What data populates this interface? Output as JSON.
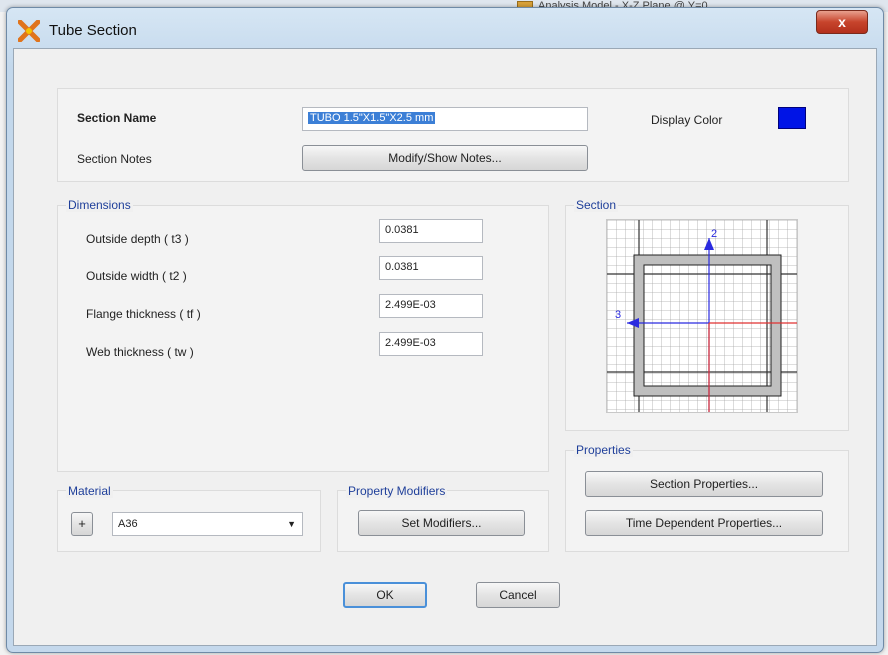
{
  "background": {
    "window_text": "Analysis Model - X-Z Plane @ Y=0"
  },
  "window": {
    "title": "Tube Section",
    "close_label": "x"
  },
  "section": {
    "name_label": "Section Name",
    "name_value": "TUBO 1.5\"X1.5\"X2.5 mm",
    "notes_label": "Section Notes",
    "notes_button": "Modify/Show Notes...",
    "display_color_label": "Display Color",
    "display_color": "#0014e6"
  },
  "dimensions": {
    "group_label": "Dimensions",
    "rows": [
      {
        "label": "Outside depth  ( t3 )",
        "value": "0.0381"
      },
      {
        "label": "Outside width  ( t2 )",
        "value": "0.0381"
      },
      {
        "label": "Flange thickness  ( tf )",
        "value": "2.499E-03"
      },
      {
        "label": "Web thickness  ( tw )",
        "value": "2.499E-03"
      }
    ]
  },
  "preview": {
    "group_label": "Section",
    "axis_vertical": "2",
    "axis_horizontal": "3"
  },
  "properties": {
    "group_label": "Properties",
    "section_properties_button": "Section Properties...",
    "time_dependent_button": "Time Dependent Properties..."
  },
  "material": {
    "group_label": "Material",
    "add_button": "+",
    "selected": "A36"
  },
  "modifiers": {
    "group_label": "Property Modifiers",
    "set_button": "Set Modifiers..."
  },
  "actions": {
    "ok": "OK",
    "cancel": "Cancel"
  },
  "colors": {
    "axis_blue": "#2a2ae0",
    "axis_red": "#e03030",
    "tube_fill": "#bfbfbf",
    "link_blue": "#1f3f9a"
  }
}
